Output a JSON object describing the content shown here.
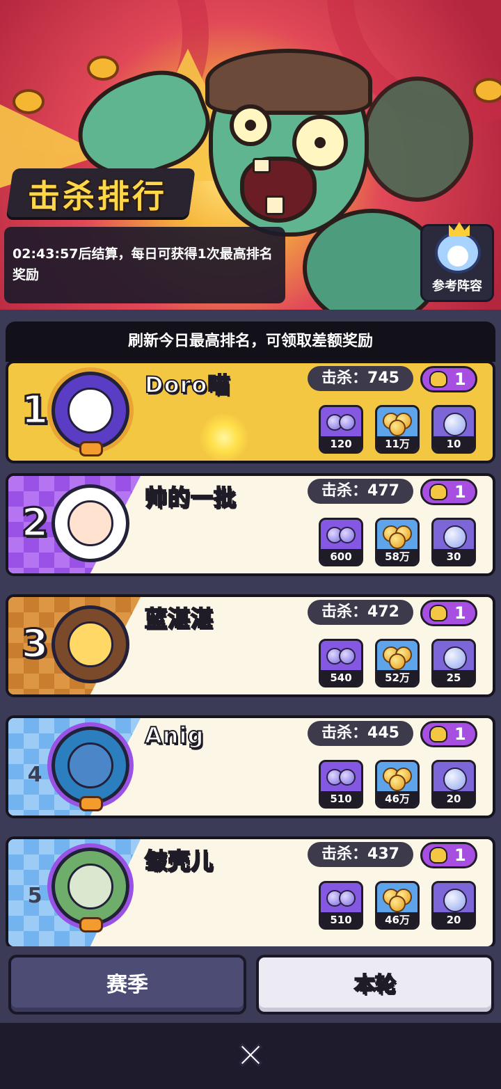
{
  "banner": {
    "title": "击杀排行",
    "notice": "02:43:57后结算，每日可获得1次最高排名奖励",
    "reference_button_label": "参考阵容"
  },
  "list": {
    "header": "刷新今日最高排名，可领取差额奖励",
    "kill_label": "击杀：",
    "rows": [
      {
        "rank": "1",
        "name": "Doro喵",
        "kills": "745",
        "skull": "1",
        "rewards": [
          "120",
          "11万",
          "10"
        ]
      },
      {
        "rank": "2",
        "name": "帅的一批",
        "kills": "477",
        "skull": "1",
        "rewards": [
          "600",
          "58万",
          "30"
        ]
      },
      {
        "rank": "3",
        "name": "蓝湛湛",
        "kills": "472",
        "skull": "1",
        "rewards": [
          "540",
          "52万",
          "25"
        ]
      },
      {
        "rank": "4",
        "name": "Anig",
        "kills": "445",
        "skull": "1",
        "rewards": [
          "510",
          "46万",
          "20"
        ]
      },
      {
        "rank": "5",
        "name": "皱壳儿",
        "kills": "437",
        "skull": "1",
        "rewards": [
          "510",
          "46万",
          "20"
        ]
      }
    ]
  },
  "tabs": {
    "season": "赛季",
    "round": "本轮",
    "selected": "本轮"
  },
  "footer": {
    "close_icon": "✕"
  },
  "colors": {
    "gold_row": "#f4c743",
    "panel_bg": "#3b3a57",
    "skull_badge": "#a64fe0"
  }
}
